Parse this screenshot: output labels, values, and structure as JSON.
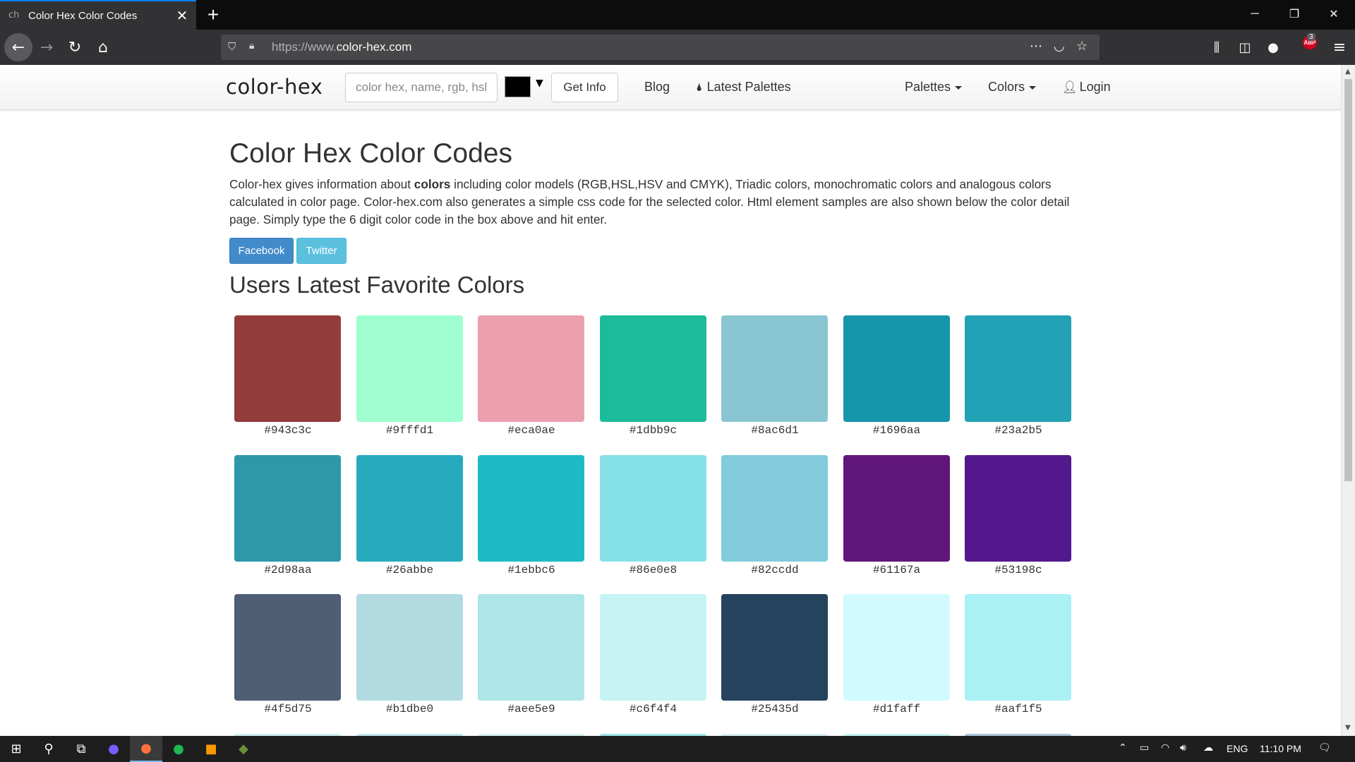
{
  "browser": {
    "tab_favicon": "ch",
    "tab_title": "Color Hex Color Codes",
    "url_prefix": "https://www.",
    "url_domain": "color-hex.com",
    "addon_badge_text": "ABP",
    "addon_badge_count": "3"
  },
  "header": {
    "brand": "color-hex",
    "search_placeholder": "color hex, name, rgb, hsl",
    "get_info_label": "Get Info",
    "nav": {
      "blog": "Blog",
      "latest_palettes": "Latest Palettes",
      "palettes": "Palettes",
      "colors": "Colors",
      "login": "Login"
    }
  },
  "main": {
    "title": "Color Hex Color Codes",
    "intro_start": "Color-hex gives information about ",
    "intro_bold": "colors",
    "intro_end": " including color models (RGB,HSL,HSV and CMYK), Triadic colors, monochromatic colors and analogous colors calculated in color page. Color-hex.com also generates a simple css code for the selected color. Html element samples are also shown below the color detail page. Simply type the 6 digit color code in the box above and hit enter.",
    "facebook_label": "Facebook",
    "twitter_label": "Twitter",
    "favorites_title": "Users Latest Favorite Colors",
    "colors": [
      [
        "#943c3c",
        "#9fffd1",
        "#eca0ae",
        "#1dbb9c",
        "#8ac6d1",
        "#1696aa",
        "#23a2b5"
      ],
      [
        "#2d98aa",
        "#26abbe",
        "#1ebbc6",
        "#86e0e8",
        "#82ccdd",
        "#61167a",
        "#53198c"
      ],
      [
        "#4f5d75",
        "#b1dbe0",
        "#aee5e9",
        "#c6f4f4",
        "#25435d",
        "#d1faff",
        "#aaf1f5"
      ]
    ]
  },
  "taskbar": {
    "language": "ENG",
    "time": "11:10 PM"
  }
}
